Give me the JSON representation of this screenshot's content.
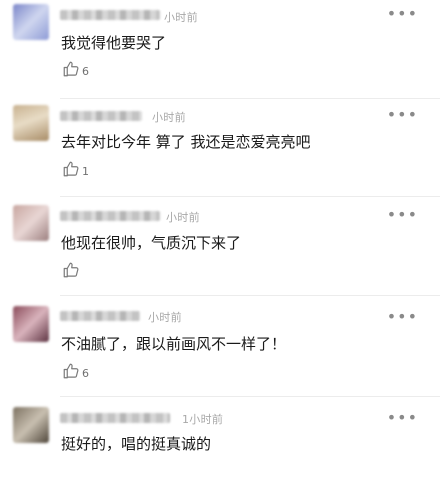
{
  "comments": [
    {
      "time": "小时前",
      "text": "我觉得他要哭了",
      "likes": "6",
      "avatar_colors": [
        "#7b86c9",
        "#cfd6ef",
        "#8e9bd6"
      ]
    },
    {
      "time": "小时前",
      "text": "去年对比今年 算了 我还是恋爱亮亮吧",
      "likes": "1",
      "avatar_colors": [
        "#c8b18f",
        "#e8dcc6",
        "#a88c66"
      ]
    },
    {
      "time": "小时前",
      "text": "他现在很帅，气质沉下来了",
      "likes": "",
      "avatar_colors": [
        "#c8a6a0",
        "#e8d6d4",
        "#9c7f7f"
      ]
    },
    {
      "time": "小时前",
      "text": "不油腻了，跟以前画风不一样了！",
      "likes": "6",
      "avatar_colors": [
        "#8a4b5a",
        "#d9b3bc",
        "#5d3342"
      ]
    },
    {
      "time": "1小时前",
      "text": "挺好的，唱的挺真诚的",
      "likes": "",
      "avatar_colors": [
        "#7d7262",
        "#c8bfb0",
        "#4f463a"
      ]
    }
  ],
  "icons": {
    "like": "thumbs-up-icon",
    "more": "more-dots-icon"
  }
}
